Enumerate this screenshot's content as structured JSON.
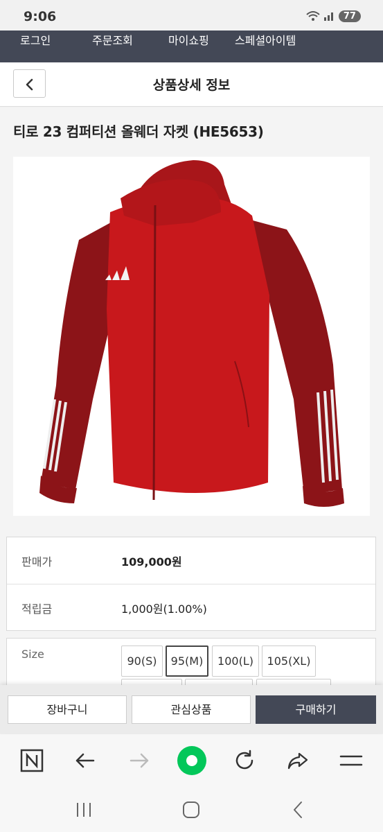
{
  "status_bar": {
    "time": "9:06",
    "battery": "77"
  },
  "top_nav": {
    "items": [
      {
        "label": "로그인"
      },
      {
        "label": "주문조회"
      },
      {
        "label": "마이쇼핑"
      },
      {
        "label": "스페셜아이템"
      }
    ]
  },
  "header": {
    "title": "상품상세 정보",
    "back_icon": "chevron-left-icon"
  },
  "product": {
    "title": "티로 23 컴퍼티션 올웨더 자켓 (HE5653)",
    "image": "red-adidas-hooded-jacket",
    "colors": {
      "jacket_main": "#c8181c",
      "jacket_sleeve": "#8c1418"
    }
  },
  "price_info": {
    "rows": [
      {
        "label": "판매가",
        "value": "109,000원"
      },
      {
        "label": "적립금",
        "value": "1,000원(1.00%)"
      }
    ]
  },
  "options": {
    "label": "Size",
    "sizes": [
      "90(S)",
      "95(M)",
      "100(L)",
      "105(XL)"
    ],
    "selected": "95(M)"
  },
  "actions": {
    "cart": "장바구니",
    "wishlist": "관심상품",
    "buy": "구매하기"
  },
  "browser_toolbar": {
    "icons": [
      "naver-n-icon",
      "back-arrow-icon",
      "forward-arrow-icon",
      "home-green-circle-icon",
      "refresh-icon",
      "share-icon",
      "menu-icon"
    ],
    "accent": "#03c75a"
  },
  "system_nav": {
    "icons": [
      "recent-apps-icon",
      "home-icon",
      "back-icon"
    ]
  },
  "colors": {
    "nav_bg": "#434856",
    "buy_bg": "#434856"
  }
}
